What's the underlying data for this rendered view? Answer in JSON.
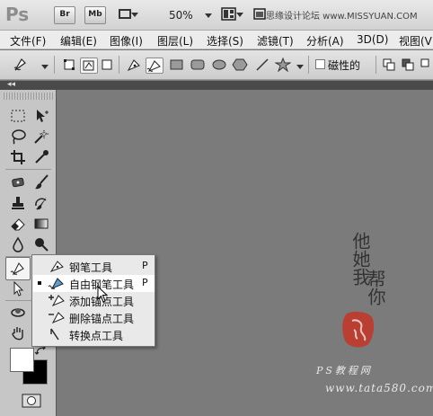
{
  "app": {
    "logo": "Ps",
    "bridge_label": "Br",
    "minibridge_label": "Mb",
    "zoom": "50%",
    "watermark": "思缘设计论坛 www.MISSYUAN.COM"
  },
  "menu": [
    "文件(F)",
    "编辑(E)",
    "图像(I)",
    "图层(L)",
    "选择(S)",
    "滤镜(T)",
    "分析(A)",
    "3D(D)",
    "视图(V)"
  ],
  "options": {
    "magnetic_label": "磁性的",
    "magnetic_checked": false
  },
  "flyout": {
    "items": [
      {
        "label": "钢笔工具",
        "shortcut": "P",
        "icon": "pen-icon",
        "selected": false
      },
      {
        "label": "自由钢笔工具",
        "shortcut": "P",
        "icon": "freeform-pen-icon",
        "selected": true
      },
      {
        "label": "添加锚点工具",
        "shortcut": "",
        "icon": "add-anchor-icon",
        "selected": false
      },
      {
        "label": "删除锚点工具",
        "shortcut": "",
        "icon": "delete-anchor-icon",
        "selected": false
      },
      {
        "label": "转换点工具",
        "shortcut": "",
        "icon": "convert-point-icon",
        "selected": false
      }
    ]
  },
  "colors": {
    "foreground": "#ffffff",
    "background": "#000000",
    "stamp": "#c0392b"
  },
  "artwork": {
    "calligraphy_col1": "他她我",
    "calligraphy_col2": "帮你",
    "site_name": "PS教程网",
    "site_url": "www.tata580.com"
  }
}
